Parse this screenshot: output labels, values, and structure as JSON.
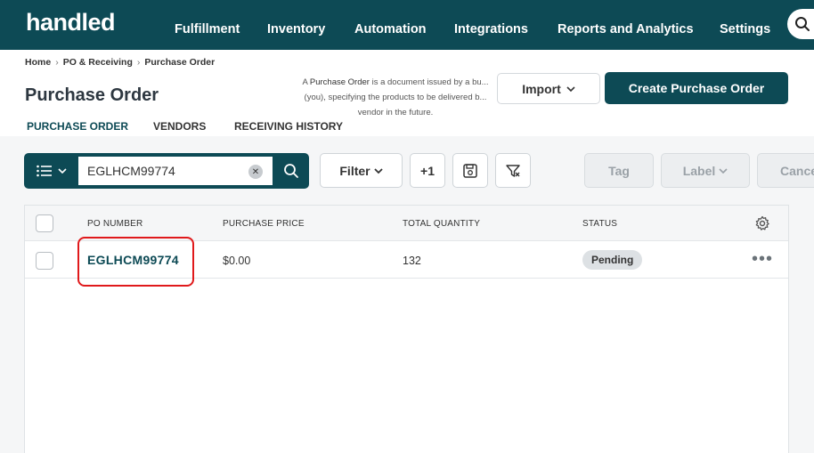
{
  "nav": {
    "logo": "handled",
    "items": [
      "Fulfillment",
      "Inventory",
      "Automation",
      "Integrations",
      "Reports and Analytics",
      "Settings"
    ]
  },
  "breadcrumb": [
    "Home",
    "PO & Receiving",
    "Purchase Order"
  ],
  "page": {
    "title": "Purchase Order",
    "description_prefix": "A",
    "description_term": "Purchase Order",
    "description_rest": "is a document issued by a bu... (you), specifying the products to be delivered b... vendor in the future."
  },
  "actions": {
    "import_label": "Import",
    "create_label": "Create Purchase Order"
  },
  "tabs": [
    {
      "label": "PURCHASE ORDER",
      "active": true
    },
    {
      "label": "VENDORS",
      "active": false
    },
    {
      "label": "RECEIVING HISTORY",
      "active": false
    }
  ],
  "toolbar": {
    "search_value": "EGLHCM99774",
    "filter_label": "Filter",
    "plus_label": "+1",
    "tag_label": "Tag",
    "label_label": "Label",
    "cancel_label": "Cance"
  },
  "table": {
    "columns": [
      "PO NUMBER",
      "PURCHASE PRICE",
      "TOTAL QUANTITY",
      "STATUS"
    ],
    "rows": [
      {
        "po_number": "EGLHCM99774",
        "price": "$0.00",
        "quantity": "132",
        "status": "Pending"
      }
    ]
  },
  "colors": {
    "brand": "#0d4a55",
    "highlight": "#e0191b"
  },
  "icons": [
    "search-icon",
    "list-icon",
    "chevron-down-icon",
    "clear-icon",
    "save-view-icon",
    "clear-filter-icon",
    "gear-icon",
    "more-icon"
  ]
}
